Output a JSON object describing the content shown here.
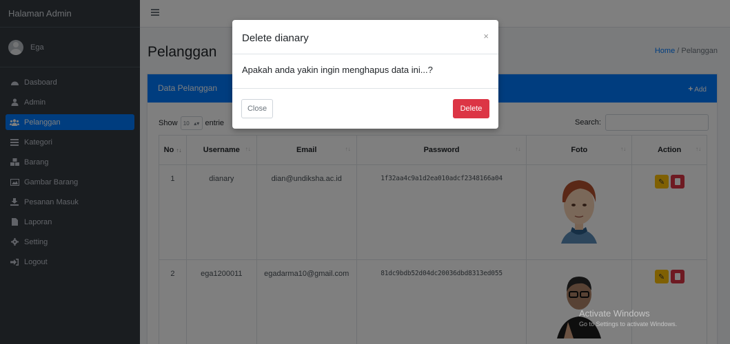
{
  "sidebar": {
    "brand": "Halaman Admin",
    "user": "Ega",
    "items": [
      {
        "label": "Dasboard",
        "icon": "dashboard-icon"
      },
      {
        "label": "Admin",
        "icon": "user-icon"
      },
      {
        "label": "Pelanggan",
        "icon": "users-icon",
        "active": true
      },
      {
        "label": "Kategori",
        "icon": "list-icon"
      },
      {
        "label": "Barang",
        "icon": "boxes-icon"
      },
      {
        "label": "Gambar Barang",
        "icon": "image-icon"
      },
      {
        "label": "Pesanan Masuk",
        "icon": "download-icon"
      },
      {
        "label": "Laporan",
        "icon": "file-icon"
      },
      {
        "label": "Setting",
        "icon": "gear-icon"
      },
      {
        "label": "Logout",
        "icon": "sign-out-icon"
      }
    ]
  },
  "page": {
    "title": "Pelanggan",
    "breadcrumb_home": "Home",
    "breadcrumb_sep": "/",
    "breadcrumb_current": "Pelanggan"
  },
  "card": {
    "title": "Data Pelanggan",
    "add_label": "Add",
    "show_label": "Show",
    "entries_value": "10",
    "entries_label": "entrie",
    "search_label": "Search:"
  },
  "table": {
    "headers": [
      "No",
      "Username",
      "Email",
      "Password",
      "Foto",
      "Action"
    ],
    "rows": [
      {
        "no": "1",
        "username": "dianary",
        "email": "dian@undiksha.ac.id",
        "password": "1f32aa4c9a1d2ea010adcf2348166a04"
      },
      {
        "no": "2",
        "username": "ega1200011",
        "email": "egadarma10@gmail.com",
        "password": "81dc9bdb52d04dc20036dbd8313ed055"
      }
    ]
  },
  "modal": {
    "title": "Delete dianary",
    "close_x": "×",
    "body": "Apakah anda yakin ingin menghapus data ini...?",
    "close_label": "Close",
    "delete_label": "Delete"
  },
  "watermark": {
    "title": "Activate Windows",
    "subtitle": "Go to Settings to activate Windows."
  },
  "colors": {
    "primary": "#007bff",
    "danger": "#dc3545",
    "warning": "#ffc107",
    "sidebar": "#343a40"
  }
}
